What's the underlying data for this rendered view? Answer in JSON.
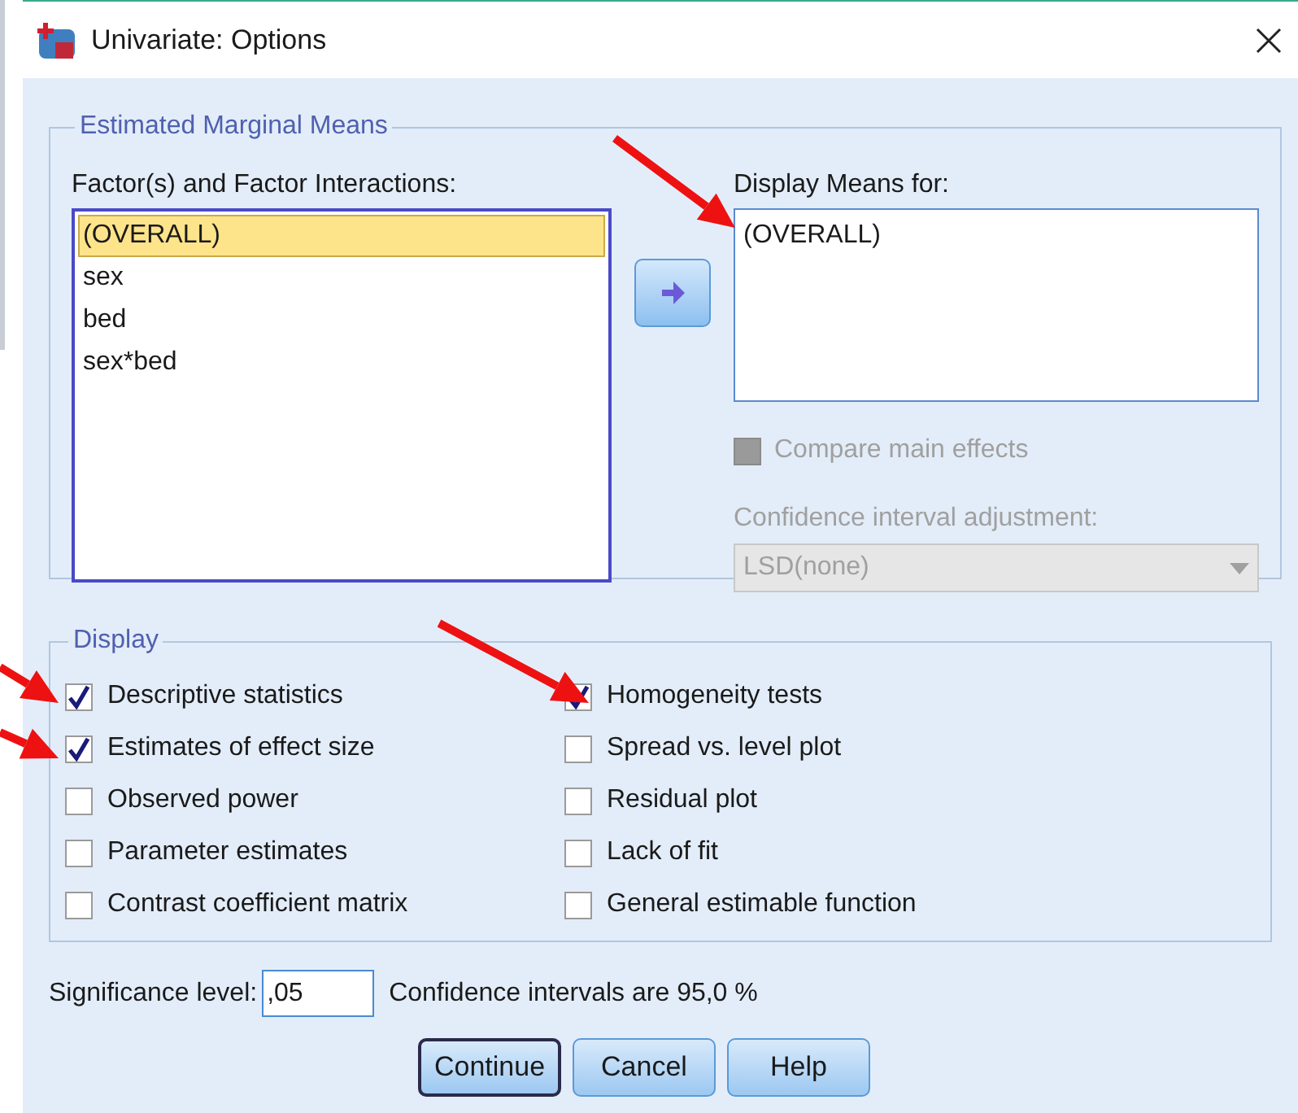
{
  "window": {
    "title": "Univariate: Options"
  },
  "estimated_marginal_means": {
    "title": "Estimated Marginal Means",
    "factors_label": "Factor(s) and Factor Interactions:",
    "factors": [
      {
        "label": "(OVERALL)",
        "selected": true
      },
      {
        "label": "sex",
        "selected": false
      },
      {
        "label": "bed",
        "selected": false
      },
      {
        "label": "sex*bed",
        "selected": false
      }
    ],
    "display_means_label": "Display Means for:",
    "display_means": [
      "(OVERALL)"
    ],
    "compare_main_effects": {
      "label": "Compare main effects",
      "checked": false,
      "disabled": true
    },
    "ci_adjustment_label": "Confidence interval adjustment:",
    "ci_adjustment": {
      "value": "LSD(none)",
      "disabled": true
    }
  },
  "display": {
    "title": "Display",
    "options": [
      {
        "label": "Descriptive statistics",
        "checked": true
      },
      {
        "label": "Estimates of effect size",
        "checked": true
      },
      {
        "label": "Observed power",
        "checked": false
      },
      {
        "label": "Parameter estimates",
        "checked": false
      },
      {
        "label": "Contrast coefficient matrix",
        "checked": false
      },
      {
        "label": "Homogeneity tests",
        "checked": true
      },
      {
        "label": "Spread vs. level plot",
        "checked": false
      },
      {
        "label": "Residual plot",
        "checked": false
      },
      {
        "label": "Lack of fit",
        "checked": false
      },
      {
        "label": "General estimable function",
        "checked": false
      }
    ]
  },
  "significance": {
    "label": "Significance level:",
    "value": ",05",
    "note": "Confidence intervals are 95,0 %"
  },
  "buttons": [
    {
      "label": "Continue",
      "default": true
    },
    {
      "label": "Cancel",
      "default": false
    },
    {
      "label": "Help",
      "default": false
    }
  ]
}
